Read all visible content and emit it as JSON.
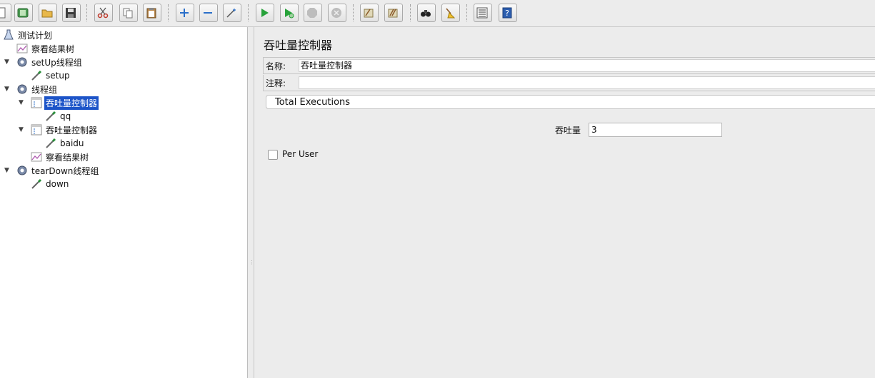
{
  "toolbar": {
    "buttons": [
      "new",
      "templates",
      "open",
      "save",
      "cut",
      "copy",
      "paste",
      "expand",
      "collapse",
      "toggle",
      "start",
      "start-no-pauses",
      "stop",
      "shutdown",
      "clear",
      "clear-all",
      "search",
      "reset-search",
      "function-helper",
      "help"
    ]
  },
  "tree": {
    "items": [
      {
        "label": "测试计划",
        "icon": "flask-icon"
      },
      {
        "label": "察看结果树",
        "icon": "graph-icon"
      },
      {
        "label": "setUp线程组",
        "icon": "gear-icon"
      },
      {
        "label": "setup",
        "icon": "pipette-icon"
      },
      {
        "label": "线程组",
        "icon": "gear-icon"
      },
      {
        "label": "吞吐量控制器",
        "icon": "controller-icon"
      },
      {
        "label": "qq",
        "icon": "pipette-icon"
      },
      {
        "label": "吞吐量控制器",
        "icon": "controller-icon"
      },
      {
        "label": "baidu",
        "icon": "pipette-icon"
      },
      {
        "label": "察看结果树",
        "icon": "graph-icon"
      },
      {
        "label": "tearDown线程组",
        "icon": "gear-icon"
      },
      {
        "label": "down",
        "icon": "pipette-icon"
      }
    ],
    "selected_index": 5
  },
  "panel": {
    "title": "吞吐量控制器",
    "name_label": "名称:",
    "name_value": "吞吐量控制器",
    "comment_label": "注释:",
    "comment_value": "",
    "mode_value": "Total Executions",
    "throughput_label": "吞吐量",
    "throughput_value": "3",
    "per_user_label": "Per User",
    "per_user_checked": false
  },
  "colors": {
    "selection": "#1c54c8",
    "background": "#ececec"
  }
}
